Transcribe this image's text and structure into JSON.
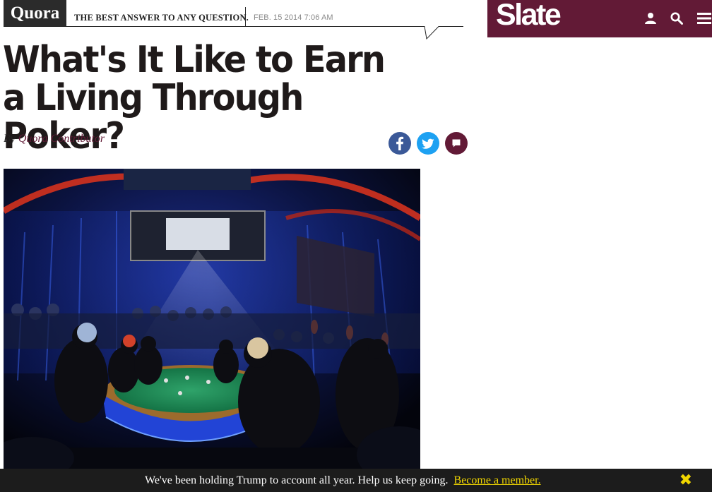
{
  "quora": {
    "logo": "Quora",
    "tagline": "THE BEST ANSWER TO ANY QUESTION.",
    "date": "FEB. 15 2014 7:06 AM"
  },
  "slate": {
    "logo": "Slate",
    "icons": [
      "user-icon",
      "search-icon",
      "menu-icon"
    ]
  },
  "article": {
    "headline": "What's It Like to Earn a Living Through Poker?",
    "byline_prefix": "By",
    "author": "Quora Contributor",
    "share_icons": [
      "facebook-icon",
      "twitter-icon",
      "comment-icon"
    ]
  },
  "banner": {
    "text": "We've been holding Trump to account all year. Help us keep going.",
    "link": "Become a member.",
    "close_icon": "close-icon"
  },
  "colors": {
    "slate_brand": "#621a36",
    "facebook": "#3b5998",
    "twitter": "#1da1f2",
    "comment": "#621a36",
    "banner_bg": "#1c1c1c",
    "banner_accent": "#f1d600"
  }
}
